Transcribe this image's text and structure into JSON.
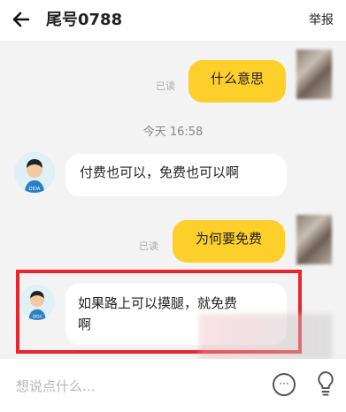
{
  "header": {
    "title": "尾号0788",
    "report_label": "举报",
    "back_icon": "back-arrow-icon"
  },
  "messages": {
    "m1": {
      "text": "什么意思",
      "read": "已读"
    },
    "time": "今天 16:58",
    "m2": {
      "text": "付费也可以，免费也可以啊"
    },
    "m3": {
      "text": "为何要免费",
      "read": "已读"
    },
    "m4": {
      "text_line1": "如果路上可以摸腿，就免费",
      "text_line2": "啊"
    },
    "avatar_label": "DIDA"
  },
  "input": {
    "placeholder": "想说点什么..."
  },
  "colors": {
    "mine_bubble": "#fdcf2b",
    "highlight": "#e8262d",
    "background": "#f3f3f3"
  }
}
